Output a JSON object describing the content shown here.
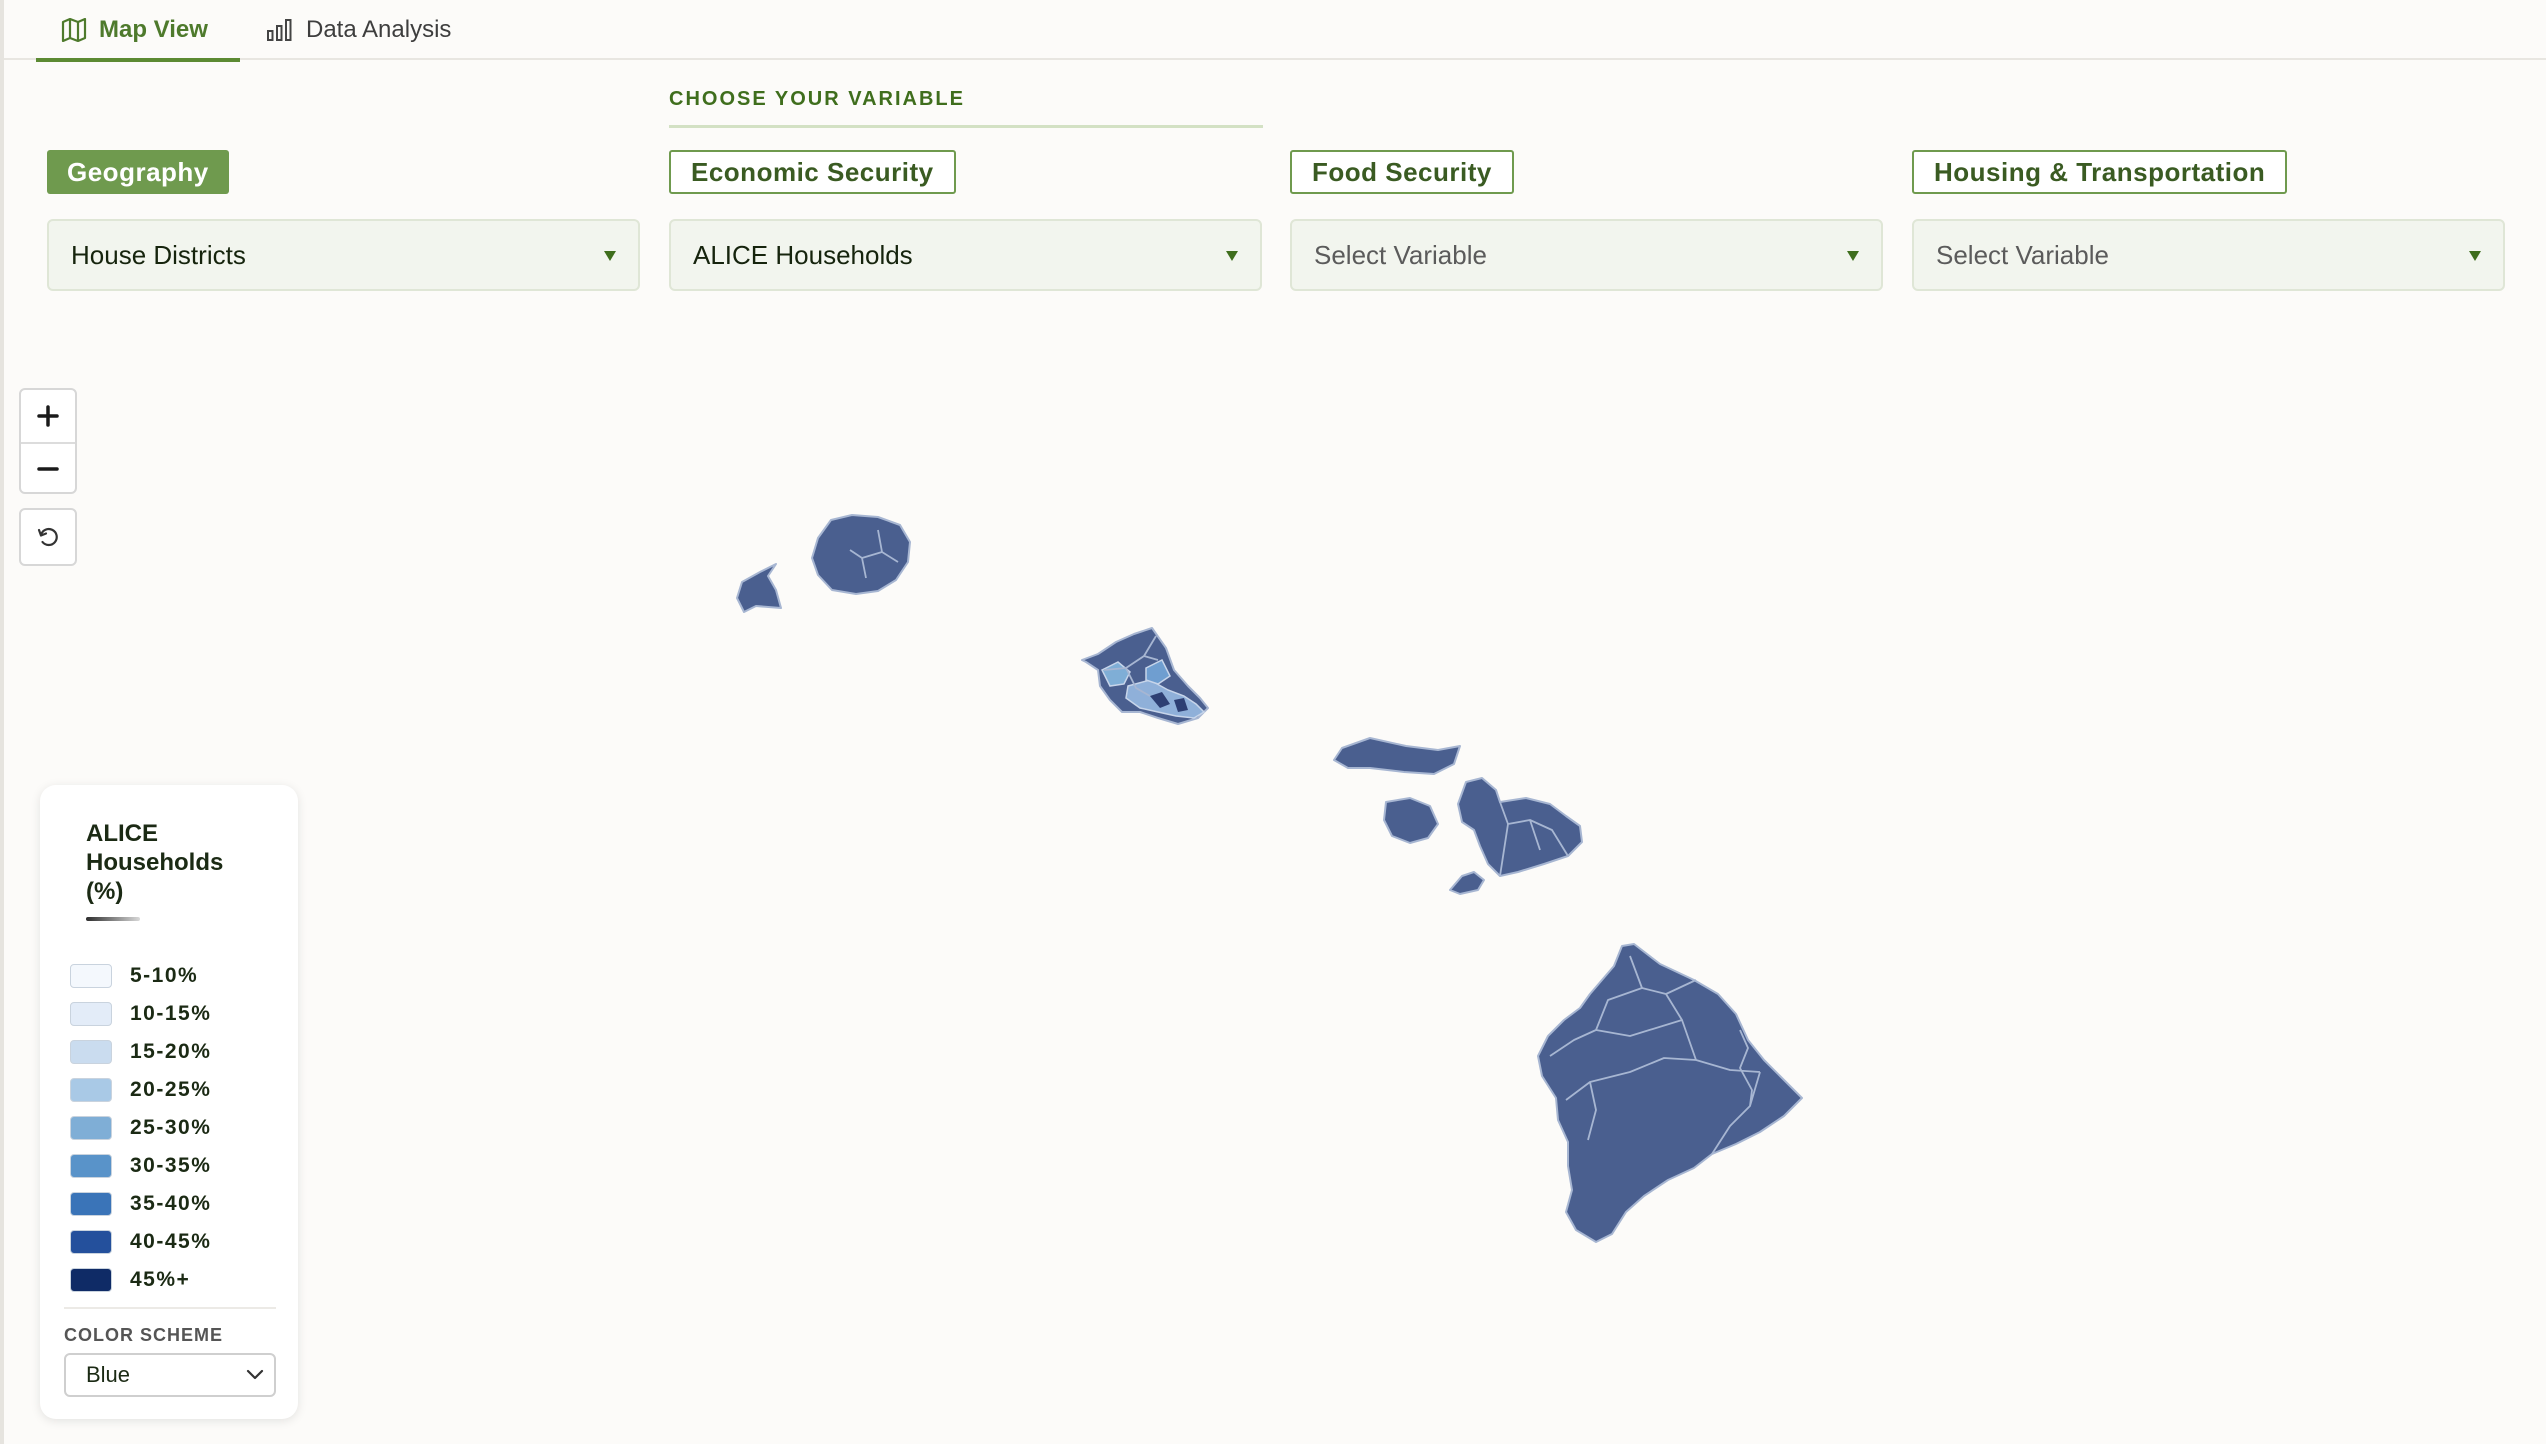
{
  "tabs": [
    {
      "label": "Map View",
      "icon": "map-icon",
      "active": true
    },
    {
      "label": "Data Analysis",
      "icon": "bar-chart-icon",
      "active": false
    }
  ],
  "section_header": "CHOOSE YOUR VARIABLE",
  "filters": [
    {
      "category": "Geography",
      "value": "House Districts"
    },
    {
      "category": "Economic Security",
      "value": "ALICE Households"
    },
    {
      "category": "Food Security",
      "placeholder": "Select Variable"
    },
    {
      "category": "Housing & Transportation",
      "placeholder": "Select Variable"
    }
  ],
  "map_controls": {
    "zoom_in": "plus-icon",
    "zoom_out": "minus-icon",
    "reset": "reset-icon"
  },
  "map": {
    "fill_color": "#4a5f8f",
    "border_color": "#9fb1cf",
    "highlight_color": "#8fb0d9"
  },
  "legend": {
    "title": "ALICE Households (%)",
    "items": [
      {
        "label": "5-10%",
        "color": "#f4f8fd"
      },
      {
        "label": "10-15%",
        "color": "#e3ecf8"
      },
      {
        "label": "15-20%",
        "color": "#cadcef"
      },
      {
        "label": "20-25%",
        "color": "#a9c9e6"
      },
      {
        "label": "25-30%",
        "color": "#7faed6"
      },
      {
        "label": "30-35%",
        "color": "#5993c9"
      },
      {
        "label": "35-40%",
        "color": "#3a74b8"
      },
      {
        "label": "40-45%",
        "color": "#24509c"
      },
      {
        "label": "45%+",
        "color": "#0f2b66"
      }
    ],
    "scheme_label": "COLOR SCHEME",
    "scheme_value": "Blue"
  }
}
